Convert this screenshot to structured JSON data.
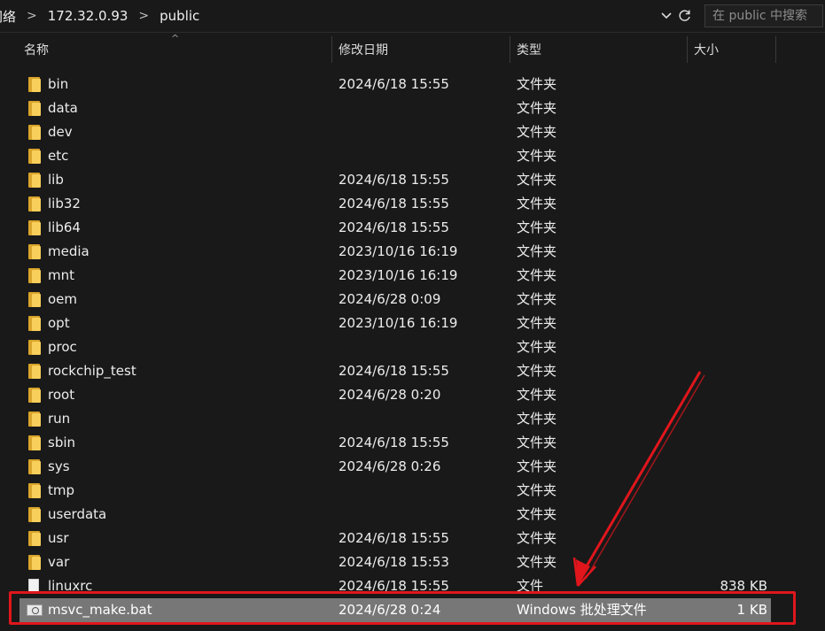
{
  "address": {
    "crumbs": [
      "网络",
      "172.32.0.93",
      "public"
    ],
    "dropdown_icon": "chevron-down-icon",
    "refresh_icon": "refresh-icon"
  },
  "search": {
    "placeholder": "在 public 中搜索"
  },
  "columns": {
    "name": "名称",
    "date": "修改日期",
    "type": "类型",
    "size": "大小"
  },
  "files": [
    {
      "name": "bin",
      "date": "2024/6/18 15:55",
      "type": "文件夹",
      "size": "",
      "icon": "folder-icon"
    },
    {
      "name": "data",
      "date": "",
      "type": "文件夹",
      "size": "",
      "icon": "folder-icon"
    },
    {
      "name": "dev",
      "date": "",
      "type": "文件夹",
      "size": "",
      "icon": "folder-icon"
    },
    {
      "name": "etc",
      "date": "",
      "type": "文件夹",
      "size": "",
      "icon": "folder-icon"
    },
    {
      "name": "lib",
      "date": "2024/6/18 15:55",
      "type": "文件夹",
      "size": "",
      "icon": "folder-icon"
    },
    {
      "name": "lib32",
      "date": "2024/6/18 15:55",
      "type": "文件夹",
      "size": "",
      "icon": "folder-icon"
    },
    {
      "name": "lib64",
      "date": "2024/6/18 15:55",
      "type": "文件夹",
      "size": "",
      "icon": "folder-icon"
    },
    {
      "name": "media",
      "date": "2023/10/16 16:19",
      "type": "文件夹",
      "size": "",
      "icon": "folder-icon"
    },
    {
      "name": "mnt",
      "date": "2023/10/16 16:19",
      "type": "文件夹",
      "size": "",
      "icon": "folder-icon"
    },
    {
      "name": "oem",
      "date": "2024/6/28 0:09",
      "type": "文件夹",
      "size": "",
      "icon": "folder-icon"
    },
    {
      "name": "opt",
      "date": "2023/10/16 16:19",
      "type": "文件夹",
      "size": "",
      "icon": "folder-icon"
    },
    {
      "name": "proc",
      "date": "",
      "type": "文件夹",
      "size": "",
      "icon": "folder-icon"
    },
    {
      "name": "rockchip_test",
      "date": "2024/6/18 15:55",
      "type": "文件夹",
      "size": "",
      "icon": "folder-icon"
    },
    {
      "name": "root",
      "date": "2024/6/28 0:20",
      "type": "文件夹",
      "size": "",
      "icon": "folder-icon"
    },
    {
      "name": "run",
      "date": "",
      "type": "文件夹",
      "size": "",
      "icon": "folder-icon"
    },
    {
      "name": "sbin",
      "date": "2024/6/18 15:55",
      "type": "文件夹",
      "size": "",
      "icon": "folder-icon"
    },
    {
      "name": "sys",
      "date": "2024/6/28 0:26",
      "type": "文件夹",
      "size": "",
      "icon": "folder-icon"
    },
    {
      "name": "tmp",
      "date": "",
      "type": "文件夹",
      "size": "",
      "icon": "folder-icon"
    },
    {
      "name": "userdata",
      "date": "",
      "type": "文件夹",
      "size": "",
      "icon": "folder-icon"
    },
    {
      "name": "usr",
      "date": "2024/6/18 15:55",
      "type": "文件夹",
      "size": "",
      "icon": "folder-icon"
    },
    {
      "name": "var",
      "date": "2024/6/18 15:53",
      "type": "文件夹",
      "size": "",
      "icon": "folder-icon"
    },
    {
      "name": "linuxrc",
      "date": "2024/6/18 15:55",
      "type": "文件",
      "size": "838 KB",
      "icon": "file-icon"
    },
    {
      "name": "msvc_make.bat",
      "date": "2024/6/28 0:24",
      "type": "Windows 批处理文件",
      "size": "1 KB",
      "icon": "batch-file-icon",
      "selected": true
    }
  ],
  "annotation": {
    "color": "#e0161c",
    "target": "msvc_make.bat"
  },
  "colors": {
    "background": "#191919",
    "selection": "#777777",
    "folder": "#f8cf5a",
    "annotation": "#e0161c"
  }
}
